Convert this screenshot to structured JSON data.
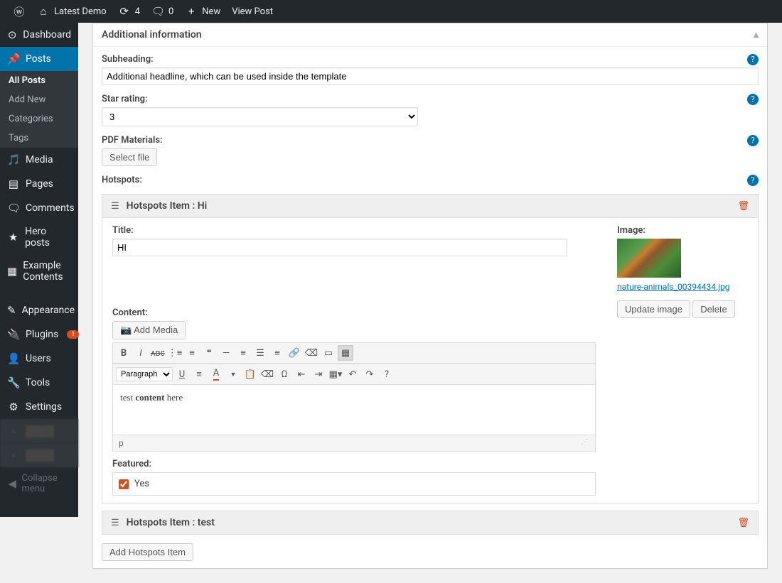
{
  "adminbar": {
    "site_name": "Latest Demo",
    "updates": "4",
    "comments": "0",
    "new_label": "New",
    "view_post": "View Post"
  },
  "sidebar": {
    "dashboard": "Dashboard",
    "posts": "Posts",
    "all_posts": "All Posts",
    "add_new": "Add New",
    "categories": "Categories",
    "tags": "Tags",
    "media": "Media",
    "pages": "Pages",
    "comments": "Comments",
    "hero_posts": "Hero posts",
    "example_contents": "Example Contents",
    "appearance": "Appearance",
    "plugins": "Plugins",
    "plugins_badge": "1",
    "users": "Users",
    "tools": "Tools",
    "settings": "Settings",
    "collapse": "Collapse menu"
  },
  "metabox": {
    "title": "Additional information",
    "subheading_label": "Subheading:",
    "subheading_value": "Additional headline, which can be used inside the template",
    "star_rating_label": "Star rating:",
    "star_rating_value": "3",
    "pdf_materials_label": "PDF Materials:",
    "select_file": "Select file",
    "hotspots_label": "Hotspots:",
    "add_hotspot": "Add Hotspots Item"
  },
  "hotspot1": {
    "header": "Hotspots Item : Hi",
    "title_label": "Title:",
    "title_value": "HI",
    "image_label": "Image:",
    "image_filename": "nature-animals_00394434.jpg",
    "update_image": "Update image",
    "delete": "Delete",
    "content_label": "Content:",
    "add_media": "Add Media",
    "paragraph": "Paragraph",
    "content_text1": "test ",
    "content_bold": "content",
    "content_text2": " here",
    "path": "p",
    "featured_label": "Featured:",
    "featured_value": "Yes"
  },
  "hotspot2": {
    "header": "Hotspots Item : test"
  }
}
